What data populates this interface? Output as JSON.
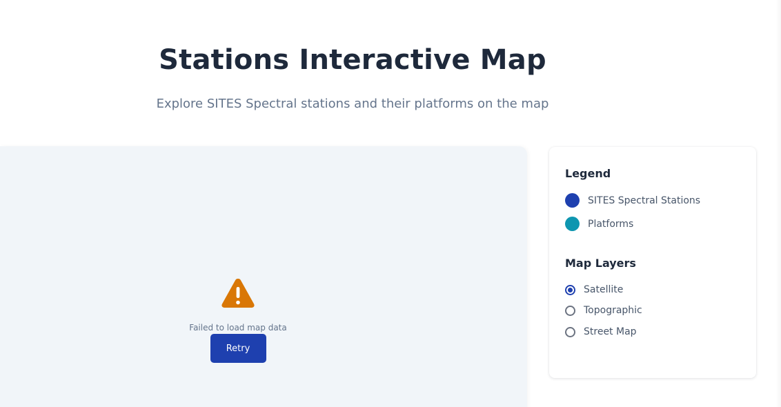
{
  "header": {
    "title": "Stations Interactive Map",
    "subtitle": "Explore SITES Spectral stations and their platforms on the map"
  },
  "map": {
    "error_icon": "warning-icon",
    "error_message": "Failed to load map data",
    "retry_label": "Retry"
  },
  "legend": {
    "heading": "Legend",
    "items": [
      {
        "label": "SITES Spectral Stations",
        "color": "#1e40af"
      },
      {
        "label": "Platforms",
        "color": "#0e96b0"
      }
    ]
  },
  "layers": {
    "heading": "Map Layers",
    "options": [
      {
        "label": "Satellite",
        "checked": true
      },
      {
        "label": "Topographic",
        "checked": false
      },
      {
        "label": "Street Map",
        "checked": false
      }
    ]
  },
  "colors": {
    "accent": "#1e40af",
    "warning": "#d97706",
    "platform": "#0e96b0"
  }
}
